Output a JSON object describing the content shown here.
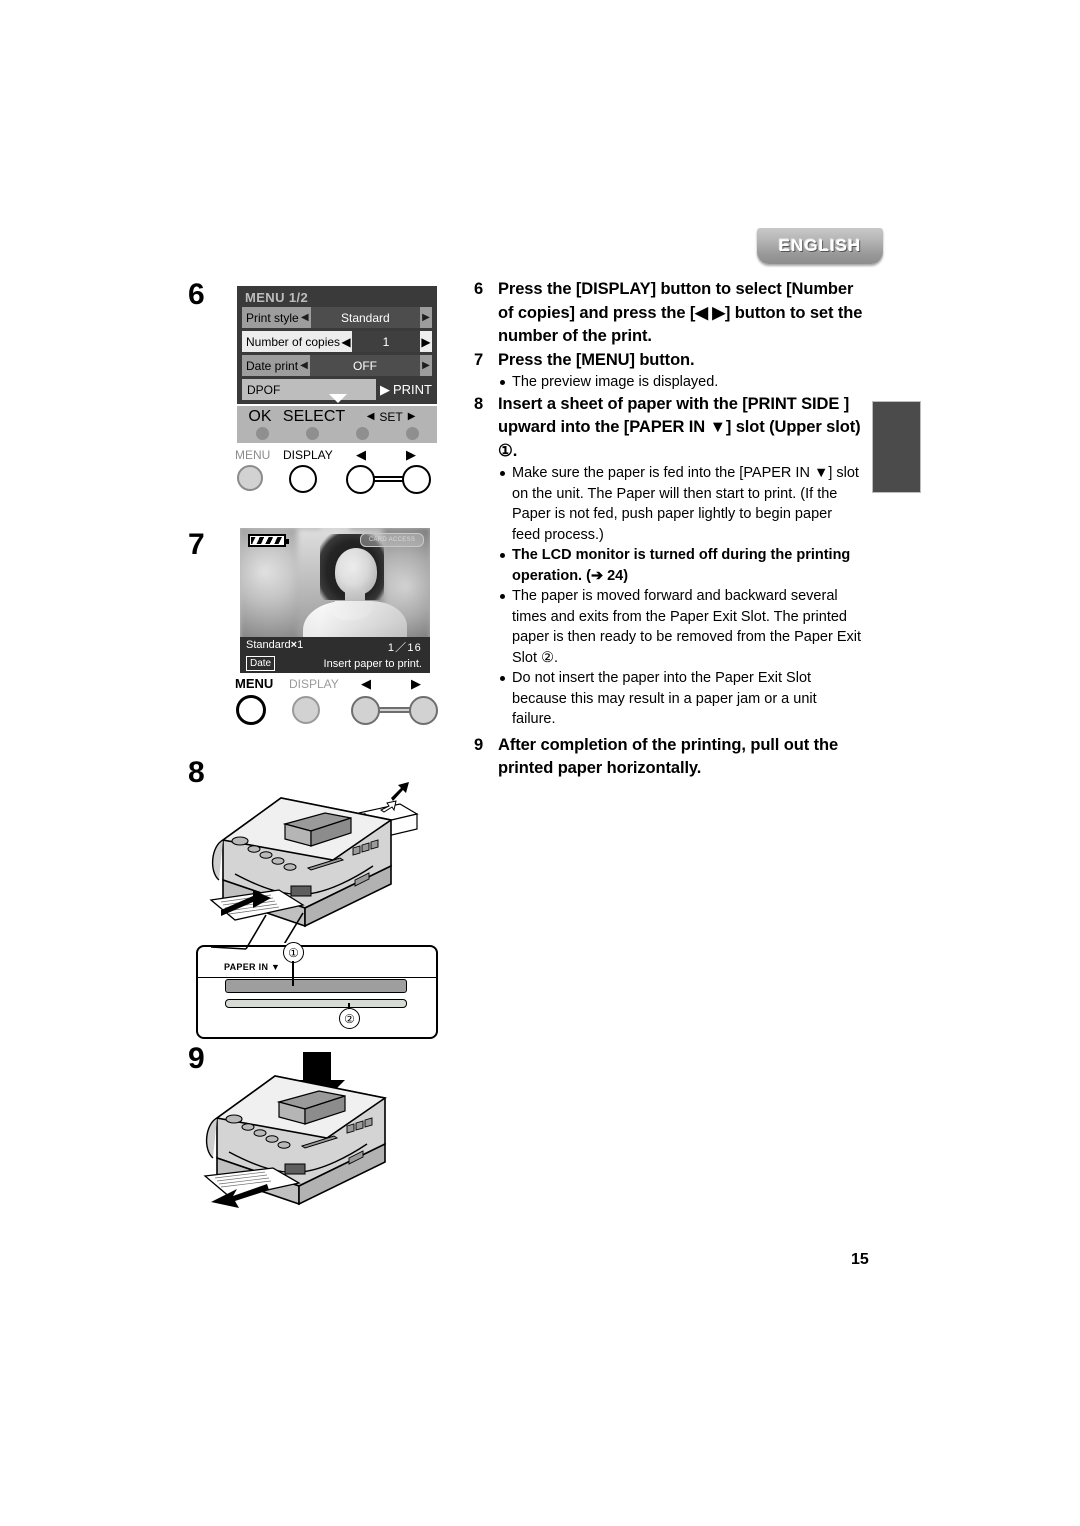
{
  "language_tab": {
    "label": "ENGLISH"
  },
  "page_number": "15",
  "menu_screen": {
    "title": "MENU  1/2",
    "rows": [
      {
        "label": "Print style",
        "value": "Standard",
        "left_arrow": "◀",
        "right_arrow": "▶",
        "selected": false
      },
      {
        "label": "Number of copies",
        "value": "1",
        "left_arrow": "◀",
        "right_arrow": "▶",
        "selected": true
      },
      {
        "label": "Date print",
        "value": "OFF",
        "left_arrow": "◀",
        "right_arrow": "▶",
        "selected": false
      }
    ],
    "dpof": {
      "label": "DPOF",
      "arrow": "▶",
      "print_label": "PRINT"
    },
    "scroll_hint_icon": "down-caret-icon",
    "softkeys": [
      {
        "label": "OK"
      },
      {
        "label": "SELECT"
      },
      {
        "label": "SET",
        "left_arrow": "◀",
        "right_arrow": "▶"
      }
    ]
  },
  "hardware_buttons": {
    "menu": "MENU",
    "display": "DISPLAY",
    "left_arrow": "◀",
    "right_arrow": "▶"
  },
  "preview_screen": {
    "card_access": "CARD ACCESS",
    "battery_icon": "battery-icon",
    "print_style": "Standard",
    "multiply": "×",
    "copies": "1",
    "date_badge": "Date",
    "index": "1／16",
    "message": "Insert paper to print."
  },
  "slot_panel": {
    "paper_in_label": "PAPER IN ▼",
    "callout_upper": "①",
    "callout_lower": "②"
  },
  "figure_step_numbers": {
    "step6": "6",
    "step7": "7",
    "step8": "8",
    "step9": "9"
  },
  "steps": [
    {
      "num": "6",
      "head": "Press the [DISPLAY] button to select [Number of copies] and press the [◀ ▶] button to set the number of the print.",
      "notes": []
    },
    {
      "num": "7",
      "head": "Press the [MENU] button.",
      "notes": [
        {
          "text": "The preview image is displayed.",
          "bold": false
        }
      ]
    },
    {
      "num": "8",
      "head": "Insert a sheet of paper with the [PRINT SIDE ] upward into the [PAPER IN ▼] slot (Upper slot) ①.",
      "notes": [
        {
          "text": "Make sure the paper is fed into the [PAPER IN ▼] slot on the unit. The Paper will then start to print. (If the Paper is not fed, push paper lightly to begin paper feed process.)",
          "bold": false
        },
        {
          "text": "The LCD monitor is turned off during the printing operation. (➔ 24)",
          "bold": true
        },
        {
          "text": "The paper is moved forward and backward several times and exits from the Paper Exit Slot. The printed paper is then ready to be removed from the Paper Exit Slot ②.",
          "bold": false
        },
        {
          "text": "Do not insert the paper into the Paper Exit Slot because this may result in a paper jam or a unit failure.",
          "bold": false
        }
      ]
    },
    {
      "num": "9",
      "head": "After completion of the printing, pull out the printed paper horizontally.",
      "notes": []
    }
  ]
}
